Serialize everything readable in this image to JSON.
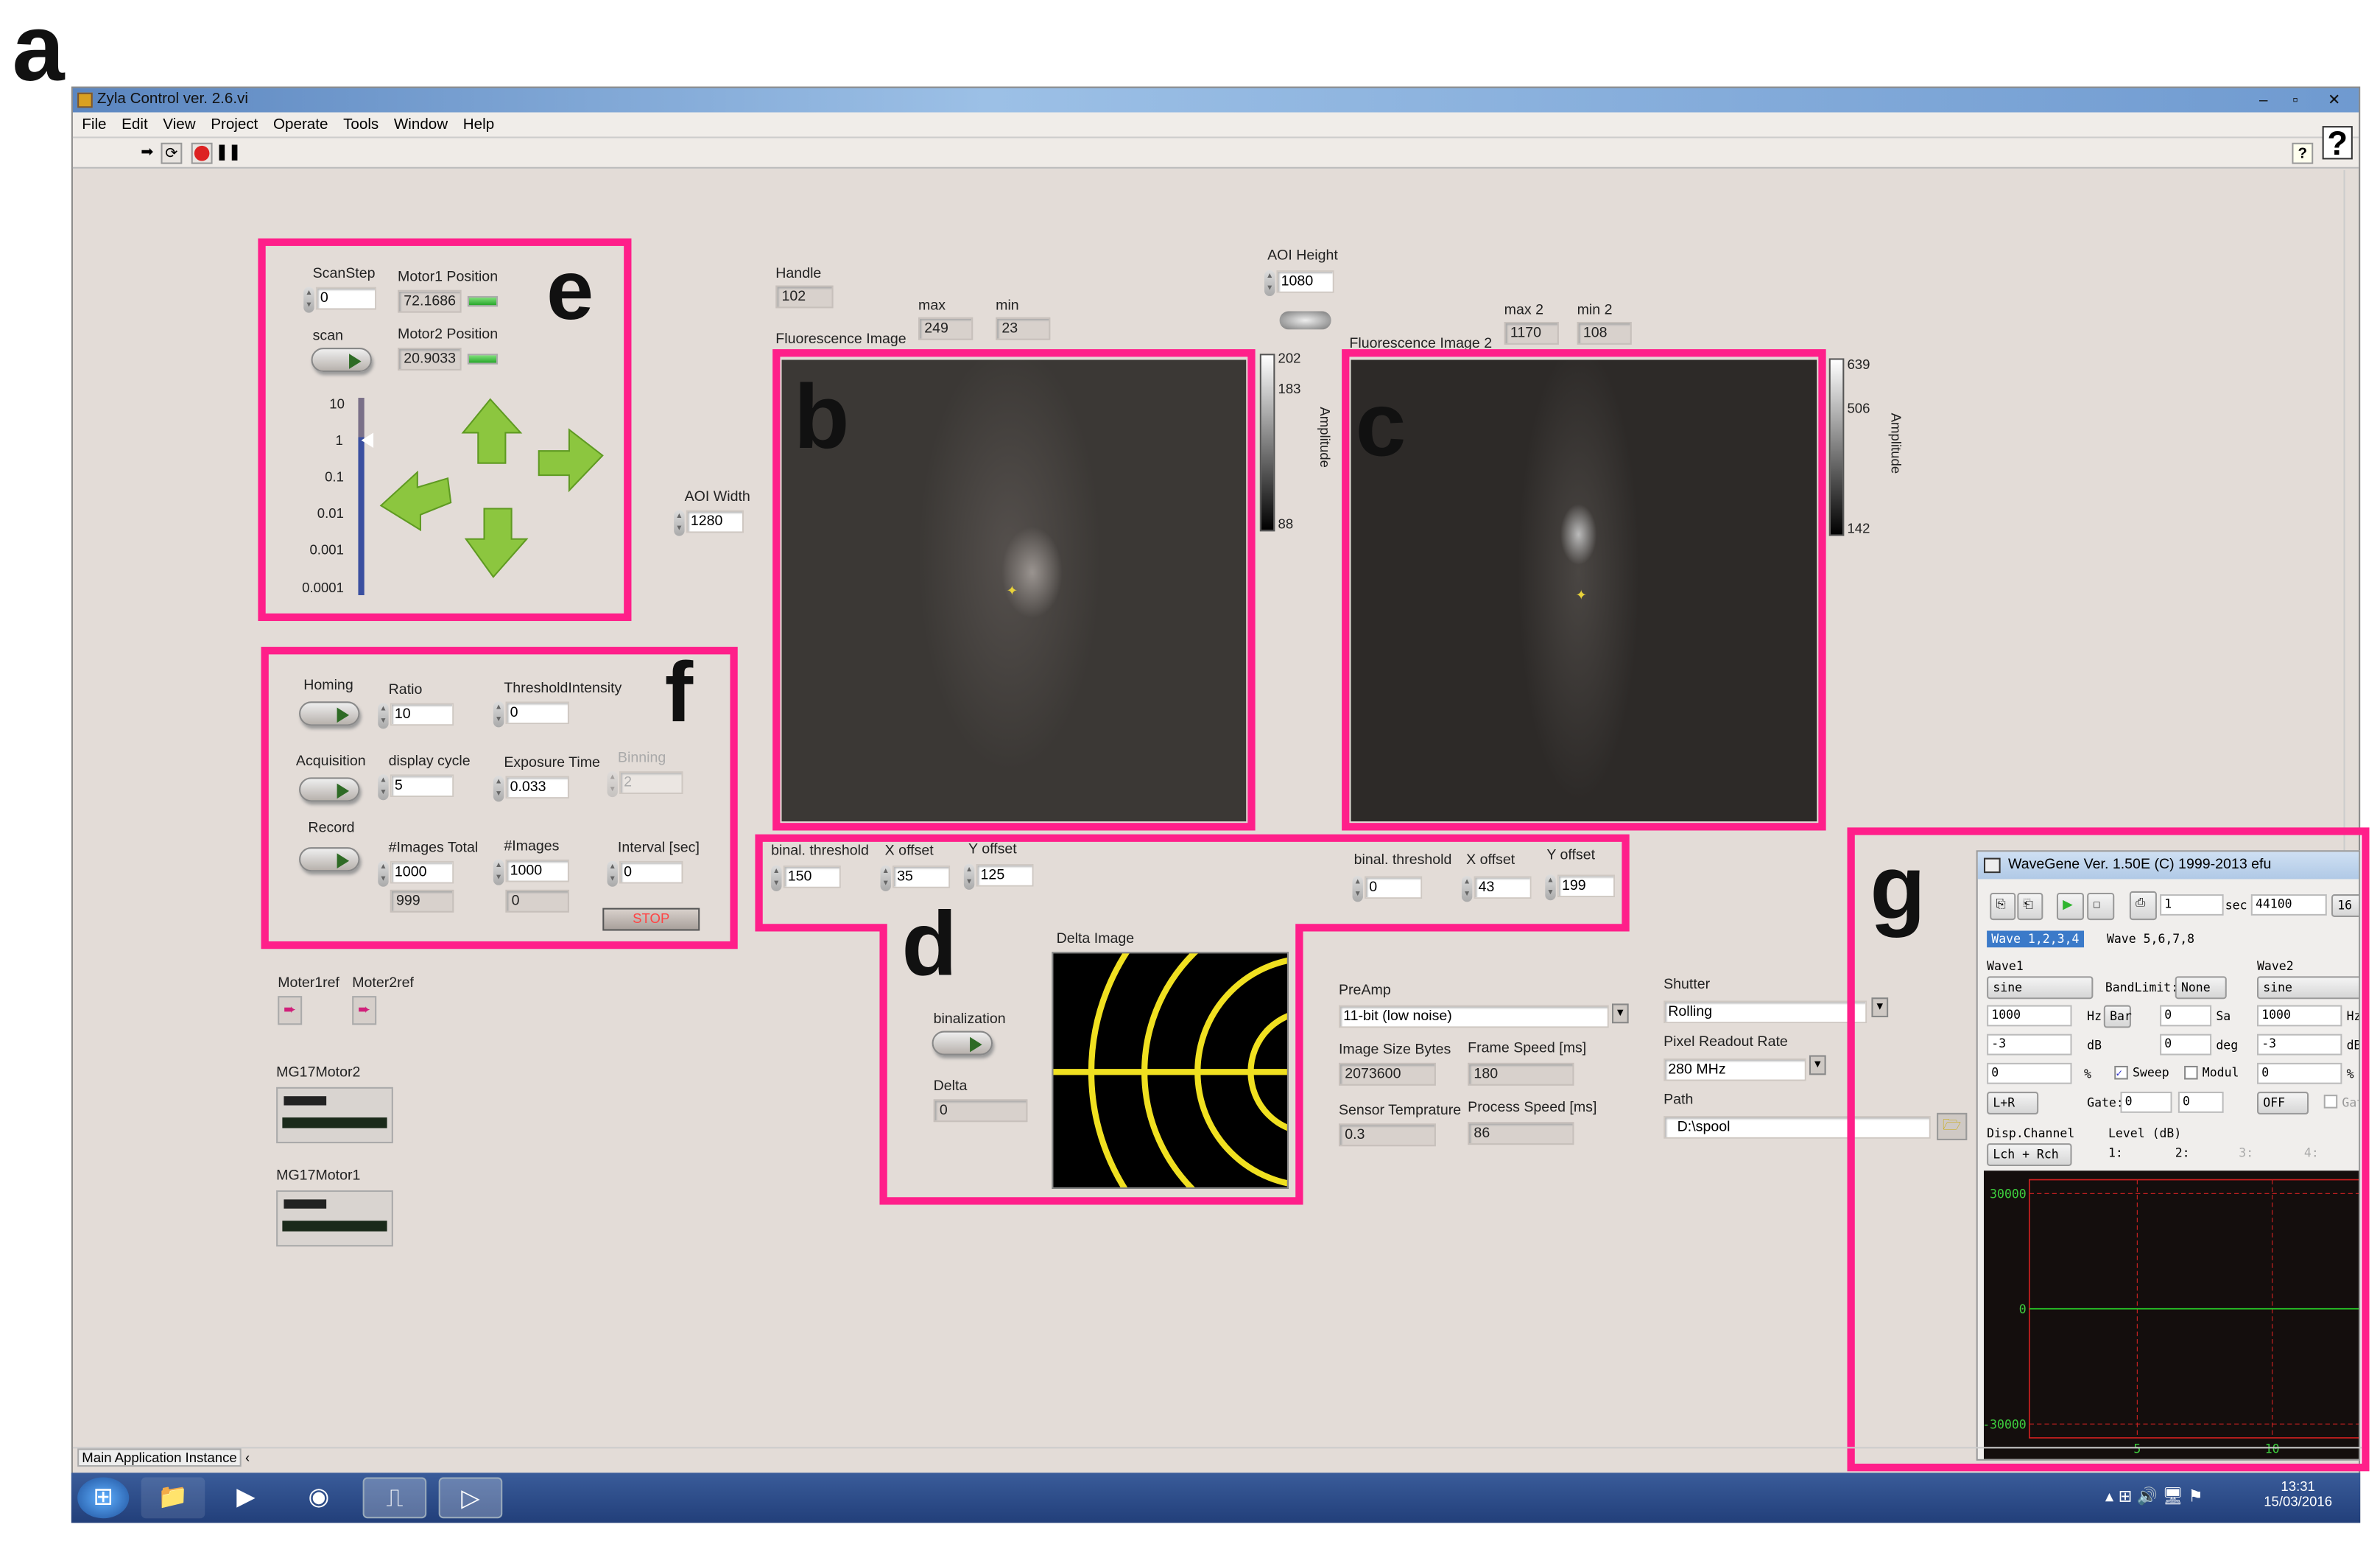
{
  "figure_labels": {
    "a": "a",
    "b": "b",
    "c": "c",
    "d": "d",
    "e": "e",
    "f": "f",
    "g": "g"
  },
  "colors": {
    "highlight": "#ff1f8a",
    "panel_bg": "#e3dcd7",
    "arrow_green": "#8cc63f",
    "scope_trace": "#27c427",
    "scope_grid": "#d02020"
  },
  "window": {
    "title": "Zyla Control ver. 2.6.vi",
    "menu": [
      "File",
      "Edit",
      "View",
      "Project",
      "Operate",
      "Tools",
      "Window",
      "Help"
    ],
    "toolbar_icons": [
      "run-arrow-icon",
      "run-continuous-icon",
      "abort-icon",
      "pause-icon"
    ],
    "help_label": "?",
    "status": "Main Application Instance"
  },
  "panel_e": {
    "scanstep_label": "ScanStep",
    "scanstep": "0",
    "motor1_label": "Motor1 Position",
    "motor1": "72.1686",
    "motor2_label": "Motor2 Position",
    "motor2": "20.9033",
    "scan_label": "scan",
    "slider_ticks": [
      "10",
      "1",
      "0.1",
      "0.01",
      "0.001",
      "0.0001"
    ],
    "slider_value": 1
  },
  "aoi": {
    "width_label": "AOI Width",
    "width": "1280",
    "height_label": "AOI Height",
    "height": "1080"
  },
  "panel_f": {
    "homing": "Homing",
    "ratio_label": "Ratio",
    "ratio": "10",
    "thr_label": "ThresholdIntensity",
    "thr": "0",
    "acq": "Acquisition",
    "cycle_label": "display cycle",
    "cycle": "5",
    "exp_label": "Exposure Time",
    "exp": "0.033",
    "bin_label": "Binning",
    "bin": "2",
    "record": "Record",
    "total_label": "#Images Total",
    "total": "1000",
    "total_count": "999",
    "images_label": "#Images",
    "images": "1000",
    "images_count": "0",
    "interval_label": "Interval [sec]",
    "interval": "0",
    "stop": "STOP"
  },
  "refs": {
    "m1": "Moter1ref",
    "m2": "Moter2ref",
    "mg2": "MG17Motor2",
    "mg1": "MG17Motor1"
  },
  "image1": {
    "handle_label": "Handle",
    "handle": "102",
    "max_label": "max",
    "max": "249",
    "min_label": "min",
    "min": "23",
    "title": "Fluorescence Image",
    "ticks": [
      "202",
      "183",
      "88"
    ],
    "axis": "Amplitude"
  },
  "image2": {
    "max_label": "max 2",
    "max": "1170",
    "min_label": "min 2",
    "min": "108",
    "title": "Fluorescence Image 2",
    "ticks": [
      "639",
      "506",
      "142"
    ],
    "axis": "Amplitude"
  },
  "panel_d": {
    "thr1_label": "binal. threshold",
    "thr1": "150",
    "x1_label": "X offset",
    "x1": "35",
    "y1_label": "Y offset",
    "y1": "125",
    "thr2_label": "binal. threshold",
    "thr2": "0",
    "x2_label": "X offset",
    "x2": "43",
    "y2_label": "Y offset",
    "y2": "199",
    "bin_label": "binalization",
    "delta_label": "Delta",
    "delta": "0",
    "delta_image": "Delta Image"
  },
  "camera": {
    "preamp_label": "PreAmp",
    "preamp": "11-bit (low noise)",
    "size_label": "Image Size Bytes",
    "size": "2073600",
    "frame_label": "Frame Speed [ms]",
    "frame": "180",
    "temp_label": "Sensor Temprature",
    "temp": "0.3",
    "proc_label": "Process Speed [ms]",
    "proc": "86",
    "shutter_label": "Shutter",
    "shutter": "Rolling",
    "rate_label": "Pixel Readout Rate",
    "rate": "280 MHz",
    "path_label": "Path",
    "path": "D:\\spool"
  },
  "wavegene": {
    "title": "WaveGene  Ver. 1.50E  (C) 1999-2013 efu",
    "sec_value": "1",
    "sec": "sec",
    "rate": "44100",
    "bits": "16",
    "tabs": [
      "Wave 1,2,3,4",
      "Wave 5,6,7,8"
    ],
    "wave1": {
      "label": "Wave1",
      "type": "sine",
      "bandlimit": "BandLimit:",
      "bandlimit_value": "None",
      "freq": "1000",
      "hz": "Hz",
      "bar": "Bar",
      "sa_value": "0",
      "sa": "Sa",
      "level": "-3",
      "db": "dB",
      "deg_value": "0",
      "deg": "deg",
      "pct": "0",
      "pct_unit": "%",
      "sweep": "Sweep",
      "sweep_checked": true,
      "modul": "Modul",
      "modul_checked": false,
      "channel": "L+R",
      "gate": "Gate:",
      "gate1": "0",
      "gate2": "0"
    },
    "wave2": {
      "label": "Wave2",
      "type": "sine",
      "freq": "1000",
      "hz": "Hz",
      "level": "-3",
      "db": "dB",
      "pct": "0",
      "pct_unit": "%",
      "channel": "OFF",
      "gate": "Gat"
    },
    "disp_label": "Disp.Channel",
    "disp": "Lch + Rch",
    "level_label": "Level (dB)",
    "levels": [
      "1:",
      "2:",
      "3:",
      "4:"
    ],
    "scope": {
      "y_ticks": [
        "30000",
        "0",
        "-30000"
      ],
      "x_ticks": [
        "5",
        "10"
      ],
      "trace_value": 0
    }
  },
  "taskbar": {
    "time": "13:31",
    "date": "15/03/2016",
    "apps": [
      "start-orb",
      "file-explorer",
      "media-player",
      "chrome",
      "labview",
      "labview-vi"
    ]
  }
}
